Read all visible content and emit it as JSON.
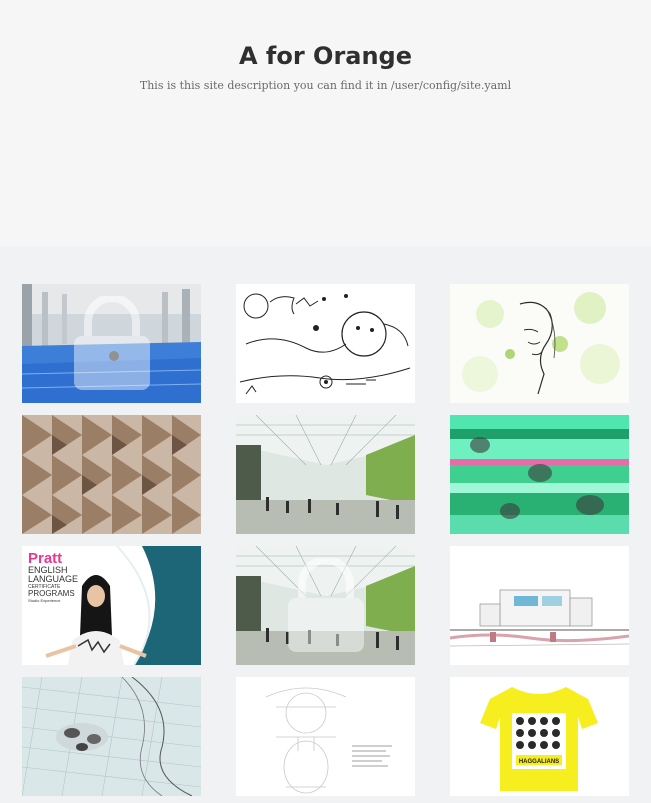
{
  "site": {
    "title": "A for Orange",
    "description": "This is this site description you can find it in /user/config/site.yaml"
  },
  "gallery": {
    "items": [
      {
        "name": "pool-interior-locked",
        "locked": true
      },
      {
        "name": "ink-sketch-drawing",
        "locked": false
      },
      {
        "name": "green-splatter-portrait",
        "locked": false
      },
      {
        "name": "folded-wood-panels",
        "locked": false
      },
      {
        "name": "atrium-rendering",
        "locked": false
      },
      {
        "name": "glitch-crowd-image",
        "locked": false
      },
      {
        "name": "pratt-program-poster",
        "locked": false,
        "text": {
          "brand": "Pratt",
          "line1": "ENGLISH",
          "line2": "LANGUAGE",
          "line3": "CERTIFICATE",
          "line4": "PROGRAMS",
          "line5": "Studio Experience"
        }
      },
      {
        "name": "atrium-rendering-locked",
        "locked": true
      },
      {
        "name": "building-section-drawing",
        "locked": false
      },
      {
        "name": "aerial-wireframe-model",
        "locked": false
      },
      {
        "name": "lightbulb-technical-drawing",
        "locked": false
      },
      {
        "name": "yellow-tshirt-print",
        "locked": false,
        "text": {
          "label": "HAGGALIANS"
        }
      }
    ]
  }
}
